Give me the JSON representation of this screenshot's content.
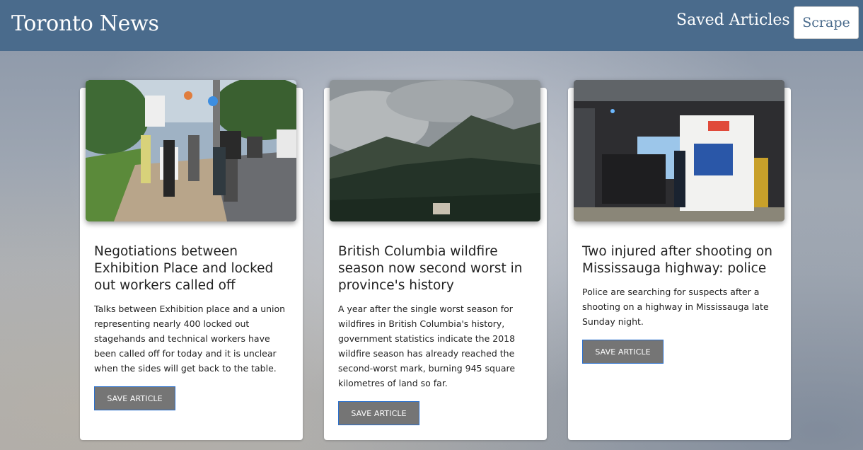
{
  "navbar": {
    "brand": "Toronto News",
    "saved_link": "Saved Articles",
    "scrape_button": "Scrape"
  },
  "articles": [
    {
      "title": "Negotiations between Exhibition Place and locked out workers called off",
      "summary": "Talks between Exhibition place and a union representing nearly 400 locked out stagehands and technical workers have been called off for today and it is unclear when the sides will get back to the table.",
      "button": "SAVE ARTICLE"
    },
    {
      "title": "British Columbia wildfire season now second worst in province's history",
      "summary": "A year after the single worst season for wildfires in British Columbia's history, government statistics indicate the 2018 wildfire season has already reached the second-worst mark, burning 945 square kilometres of land so far.",
      "button": "SAVE ARTICLE"
    },
    {
      "title": "Two injured after shooting on Mississauga highway: police",
      "summary": "Police are searching for suspects after a shooting on a highway in Mississauga late Sunday night.",
      "button": "SAVE ARTICLE"
    }
  ],
  "colors": {
    "navbar": "#4a6b8c",
    "button": "#757575",
    "button_border": "#2a6fcc"
  }
}
